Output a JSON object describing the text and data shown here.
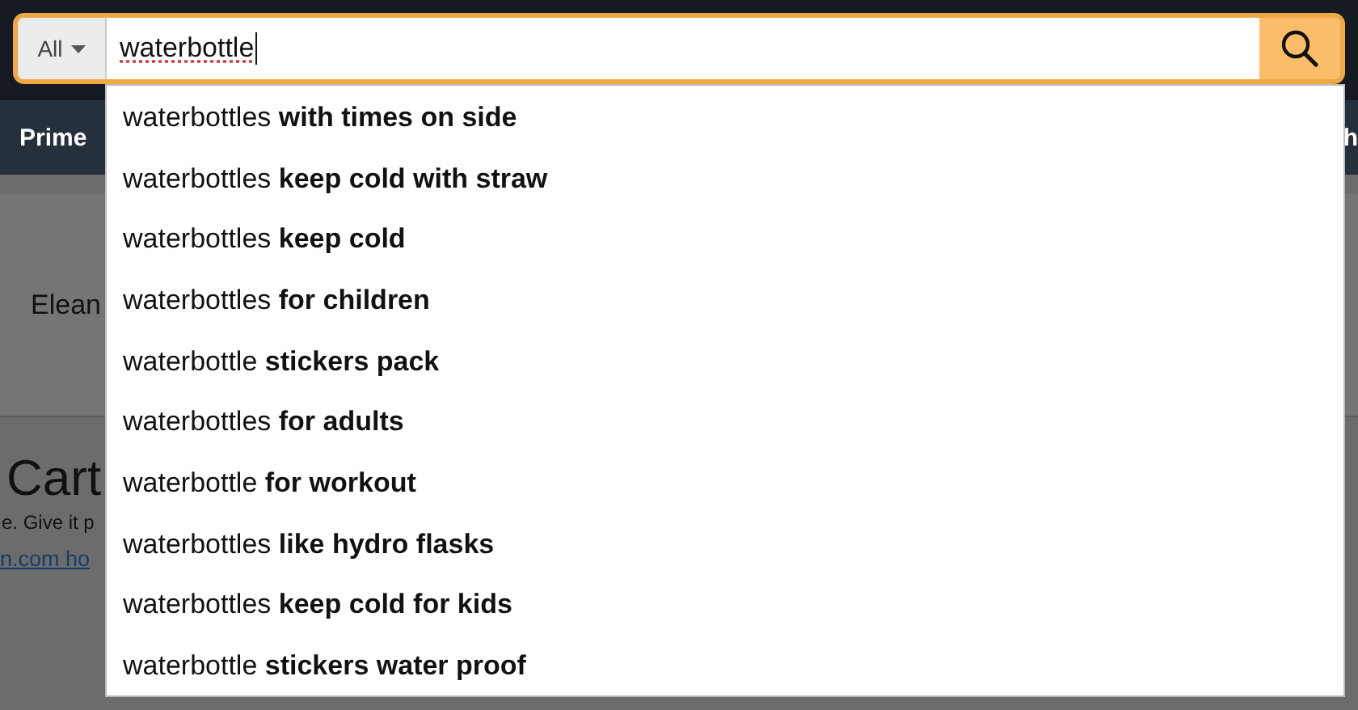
{
  "search": {
    "category": "All",
    "value": "waterbottle",
    "misspelled": true
  },
  "nav": {
    "left_item": "Prime",
    "right_item": "h"
  },
  "account": {
    "name": "Elean"
  },
  "cart": {
    "title": "Cart",
    "message": "e. Give it p",
    "link": "n.com ho"
  },
  "suggestions": [
    "waterbottles **with times on side**",
    "waterbottles **keep cold with straw**",
    "waterbottles **keep cold**",
    "waterbottles **for children**",
    "waterbottle **stickers pack**",
    "waterbottles **for adults**",
    "waterbottle **for workout**",
    "waterbottles **like hydro flasks**",
    "waterbottles **keep cold for kids**",
    "waterbottle **stickers water proof**"
  ]
}
